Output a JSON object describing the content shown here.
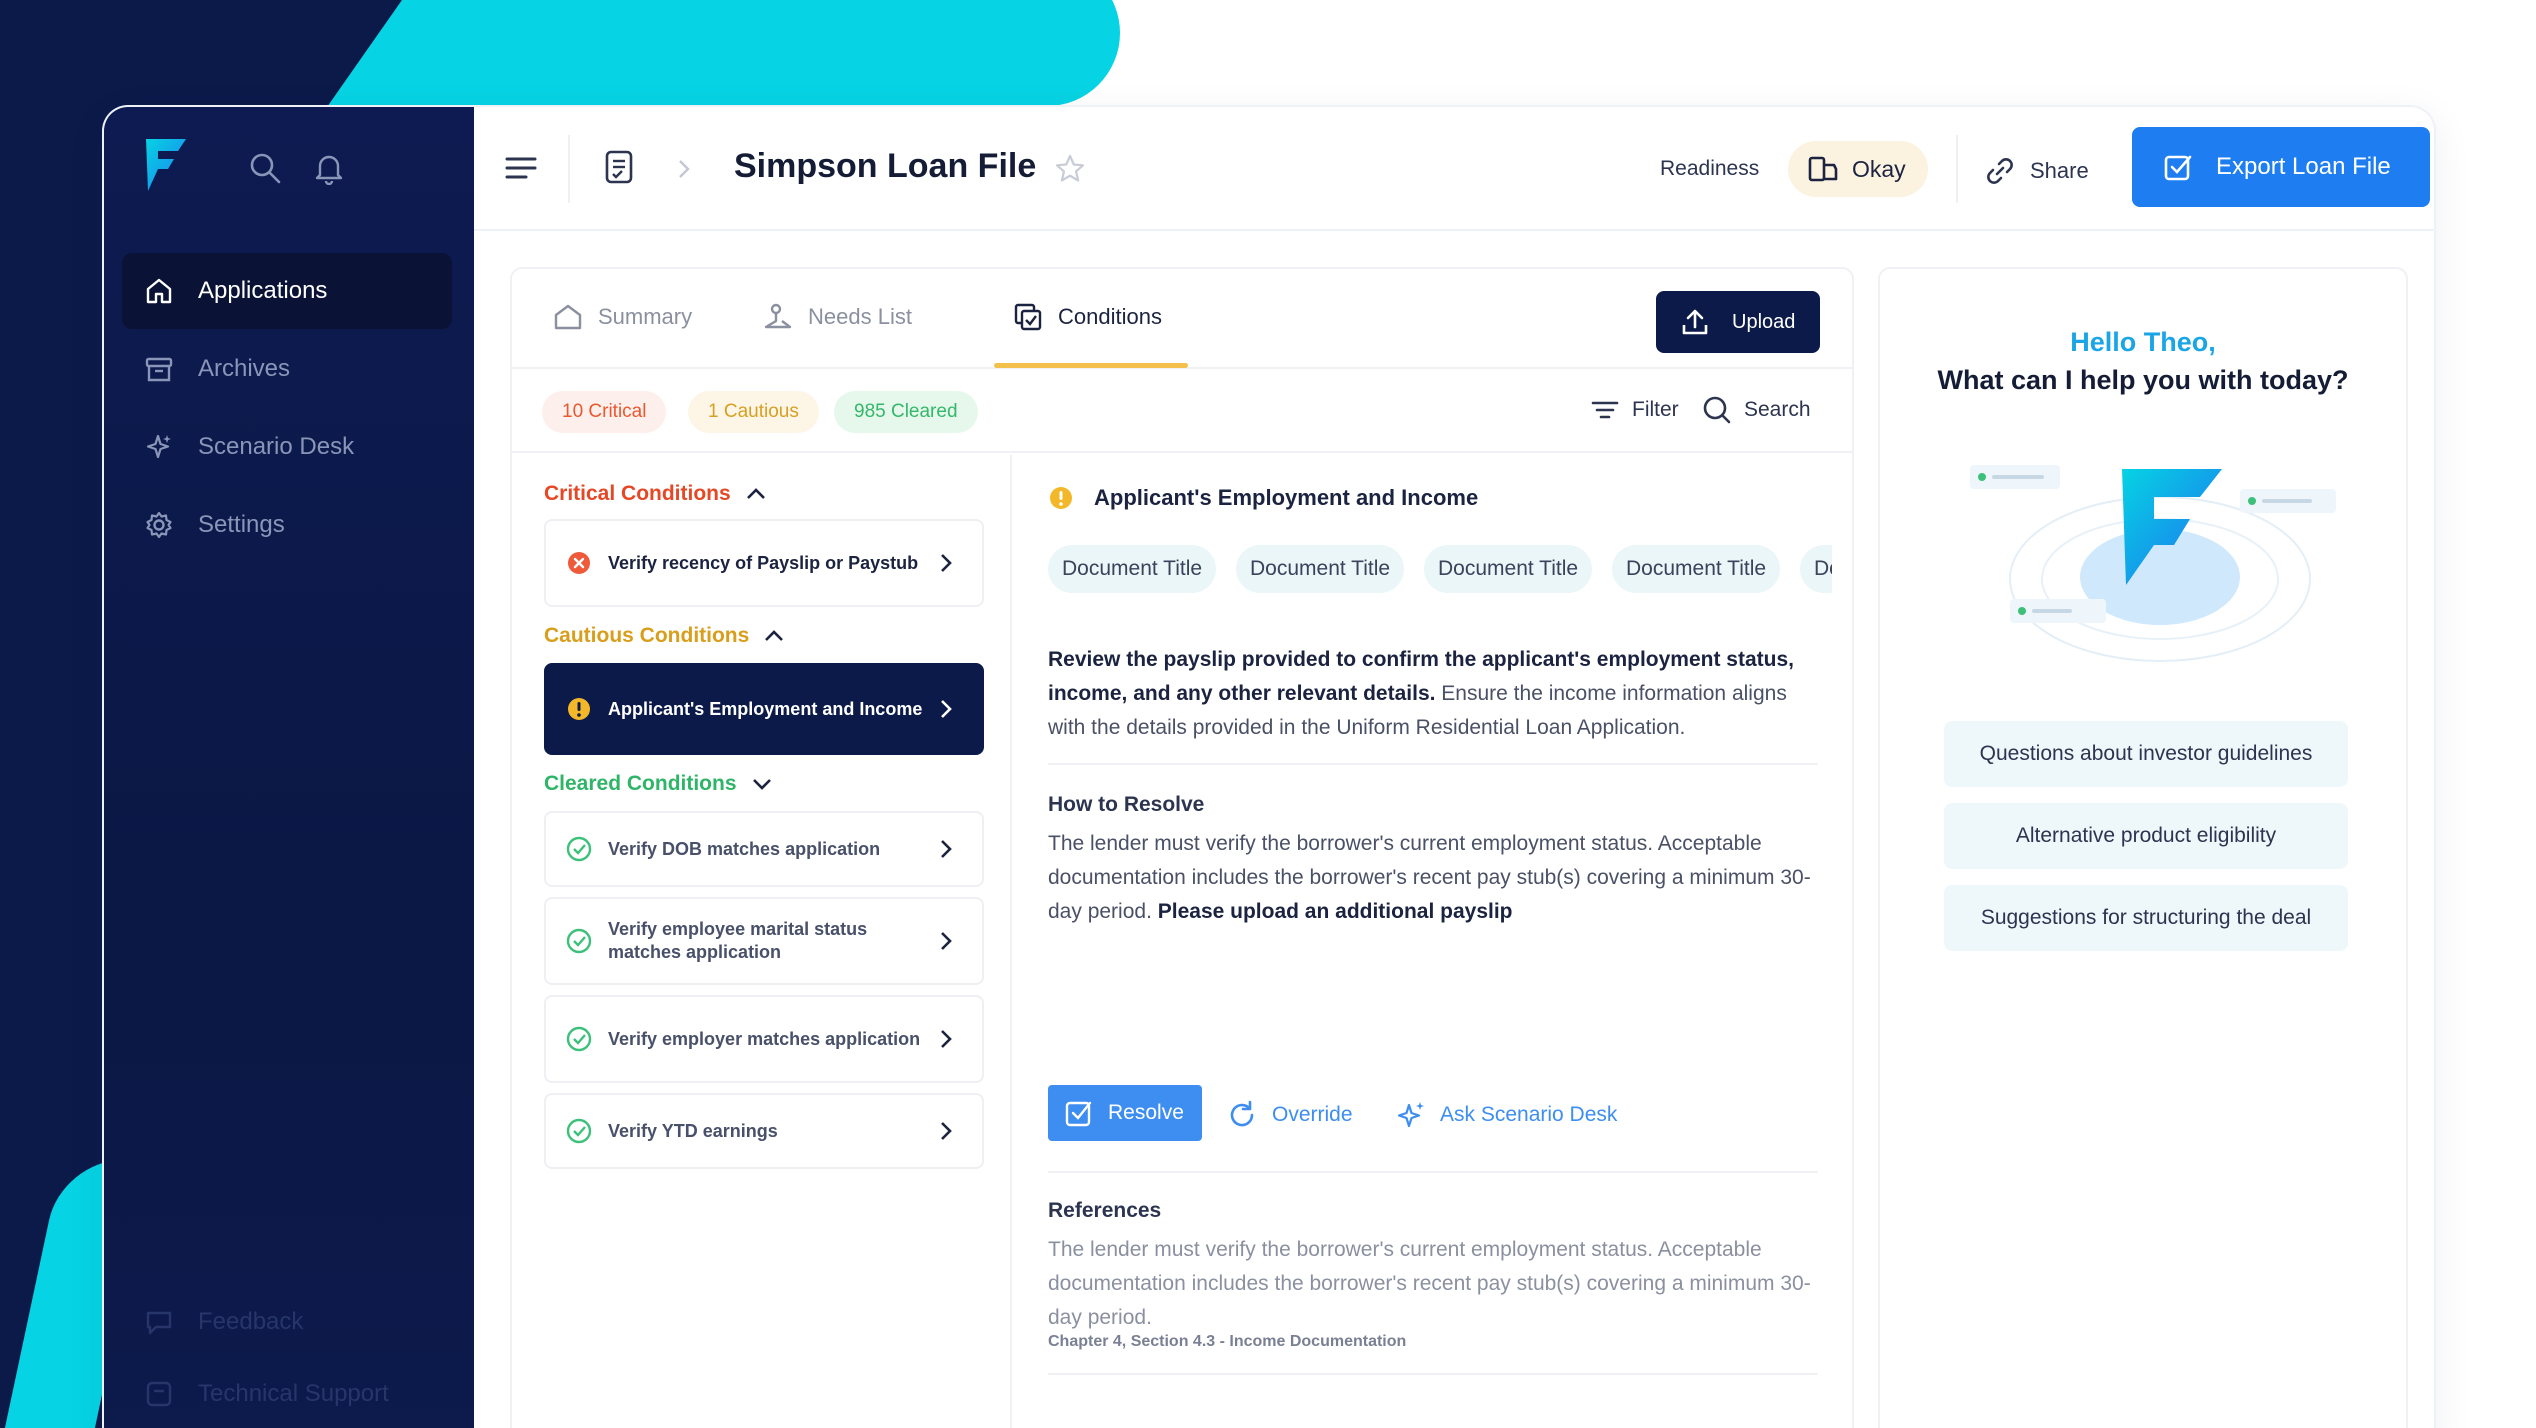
{
  "sidebar": {
    "items": [
      {
        "label": "Applications",
        "icon": "home-icon",
        "active": true
      },
      {
        "label": "Archives",
        "icon": "archive-icon"
      },
      {
        "label": "Scenario Desk",
        "icon": "sparkle-icon"
      },
      {
        "label": "Settings",
        "icon": "gear-icon"
      }
    ],
    "bottom": [
      {
        "label": "Feedback",
        "icon": "feedback-icon"
      },
      {
        "label": "Technical Support",
        "icon": "support-icon"
      }
    ]
  },
  "header": {
    "title": "Simpson Loan File",
    "readiness_label": "Readiness",
    "readiness_value": "Okay",
    "share_label": "Share",
    "export_label": "Export Loan File"
  },
  "tabs": [
    {
      "label": "Summary",
      "icon": "home-outline-icon"
    },
    {
      "label": "Needs List",
      "icon": "needs-list-icon"
    },
    {
      "label": "Conditions",
      "icon": "conditions-icon",
      "active": true
    }
  ],
  "upload_label": "Upload",
  "status_chips": {
    "critical": "10 Critical",
    "cautious": "1 Cautious",
    "cleared": "985 Cleared"
  },
  "filter_label": "Filter",
  "search_label": "Search",
  "groups": {
    "critical": {
      "title": "Critical Conditions",
      "items": [
        "Verify recency of Payslip or Paystub"
      ]
    },
    "cautious": {
      "title": "Cautious Conditions",
      "items": [
        "Applicant's Employment and Income"
      ]
    },
    "cleared": {
      "title": "Cleared Conditions",
      "items": [
        "Verify DOB matches application",
        "Verify employee marital status matches application",
        "Verify employer matches application",
        "Verify YTD earnings"
      ]
    }
  },
  "detail": {
    "title": "Applicant's Employment and Income",
    "documents": [
      "Document Title",
      "Document Title",
      "Document Title",
      "Document Title",
      "Doc"
    ],
    "intro_bold": "Review the payslip provided to confirm the applicant's employment status, income, and any other relevant details.",
    "intro_rest": " Ensure the income information aligns with the details provided in the Uniform Residential Loan Application.",
    "how_title": "How to Resolve",
    "how_text": "The lender must verify the borrower's current employment status. Acceptable documentation includes the borrower's recent pay stub(s) covering a minimum 30-day period.",
    "how_bold": " Please upload an additional payslip",
    "resolve_label": "Resolve",
    "override_label": "Override",
    "ask_label": "Ask Scenario Desk",
    "refs_title": "References",
    "refs_text": "The lender must verify the borrower's current employment status. Acceptable documentation includes the borrower's recent pay stub(s) covering a minimum 30-day period.",
    "chapter": "Chapter 4, Section 4.3 - Income Documentation"
  },
  "assistant": {
    "hello": "Hello Theo,",
    "question": "What can I help you with today?",
    "suggestions": [
      "Questions about investor guidelines",
      "Alternative product eligibility",
      "Suggestions for structuring the deal"
    ]
  },
  "colors": {
    "brand_dark": "#0c1a4a",
    "accent_cyan": "#06d3e3",
    "primary_blue": "#1e7df0",
    "critical": "#e64826",
    "cautious": "#d99e1b",
    "cleared": "#2fb568"
  }
}
